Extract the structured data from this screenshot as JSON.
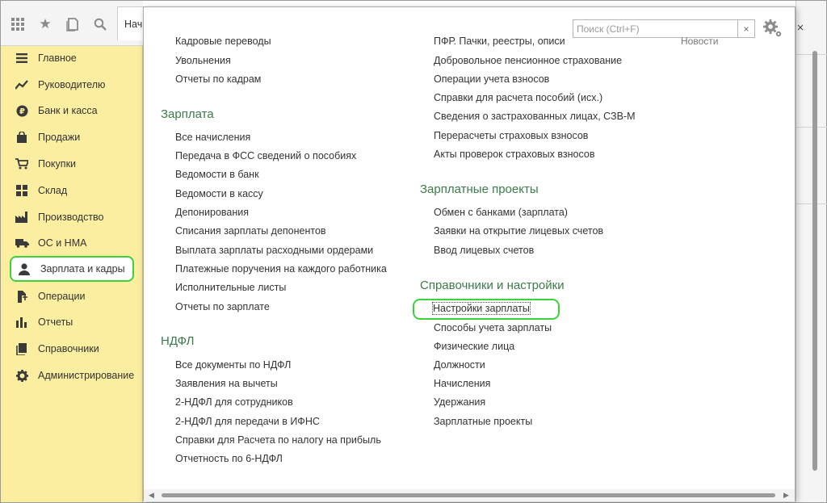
{
  "toolbar": {
    "start_tab_label": "Нач"
  },
  "search": {
    "placeholder": "Поиск (Ctrl+F)",
    "clear_label": "×"
  },
  "window": {
    "close_label": "×",
    "background_text": "Новости"
  },
  "sidebar": {
    "items": [
      {
        "label": "Главное",
        "icon": "menu-lines-icon"
      },
      {
        "label": "Руководителю",
        "icon": "trend-chart-icon"
      },
      {
        "label": "Банк и касса",
        "icon": "ruble-coin-icon"
      },
      {
        "label": "Продажи",
        "icon": "shopping-bag-icon"
      },
      {
        "label": "Покупки",
        "icon": "shopping-cart-icon"
      },
      {
        "label": "Склад",
        "icon": "warehouse-grid-icon"
      },
      {
        "label": "Производство",
        "icon": "factory-icon"
      },
      {
        "label": "ОС и НМА",
        "icon": "truck-icon"
      },
      {
        "label": "Зарплата и кадры",
        "icon": "person-icon"
      },
      {
        "label": "Операции",
        "icon": "operations-icon"
      },
      {
        "label": "Отчеты",
        "icon": "bar-chart-icon"
      },
      {
        "label": "Справочники",
        "icon": "books-icon"
      },
      {
        "label": "Администрирование",
        "icon": "gear-icon"
      }
    ],
    "active_index": 8
  },
  "left_column": {
    "top_links": [
      "Кадровые переводы",
      "Увольнения",
      "Отчеты по кадрам"
    ],
    "salary": {
      "title": "Зарплата",
      "links": [
        "Все начисления",
        "Передача в ФСС сведений о пособиях",
        "Ведомости в банк",
        "Ведомости в кассу",
        "Депонирования",
        "Списания зарплаты депонентов",
        "Выплата зарплаты расходными ордерами",
        "Платежные поручения на каждого работника",
        "Исполнительные листы",
        "Отчеты по зарплате"
      ]
    },
    "ndfl": {
      "title": "НДФЛ",
      "links": [
        "Все документы по НДФЛ",
        "Заявления на вычеты",
        "2-НДФЛ для сотрудников",
        "2-НДФЛ для передачи в ИФНС",
        "Справки для Расчета по налогу на прибыль",
        "Отчетность по 6-НДФЛ"
      ]
    }
  },
  "right_column": {
    "top_links": [
      "ПФР. Пачки, реестры, описи",
      "Добровольное пенсионное страхование",
      "Операции учета взносов",
      "Справки для расчета пособий (исх.)",
      "Сведения о застрахованных лицах, СЗВ-М",
      "Перерасчеты страховых взносов",
      "Акты проверок страховых взносов"
    ],
    "projects": {
      "title": "Зарплатные проекты",
      "links": [
        "Обмен с банками (зарплата)",
        "Заявки на открытие лицевых счетов",
        "Ввод лицевых счетов"
      ]
    },
    "settings": {
      "title": "Справочники и настройки",
      "links": [
        "Настройки зарплаты",
        "Способы учета зарплаты",
        "Физические лица",
        "Должности",
        "Начисления",
        "Удержания",
        "Зарплатные проекты"
      ]
    }
  },
  "colors": {
    "sidebar_bg": "#fbeea0",
    "section_title": "#3c7a4a",
    "highlight": "#3ad33a"
  }
}
